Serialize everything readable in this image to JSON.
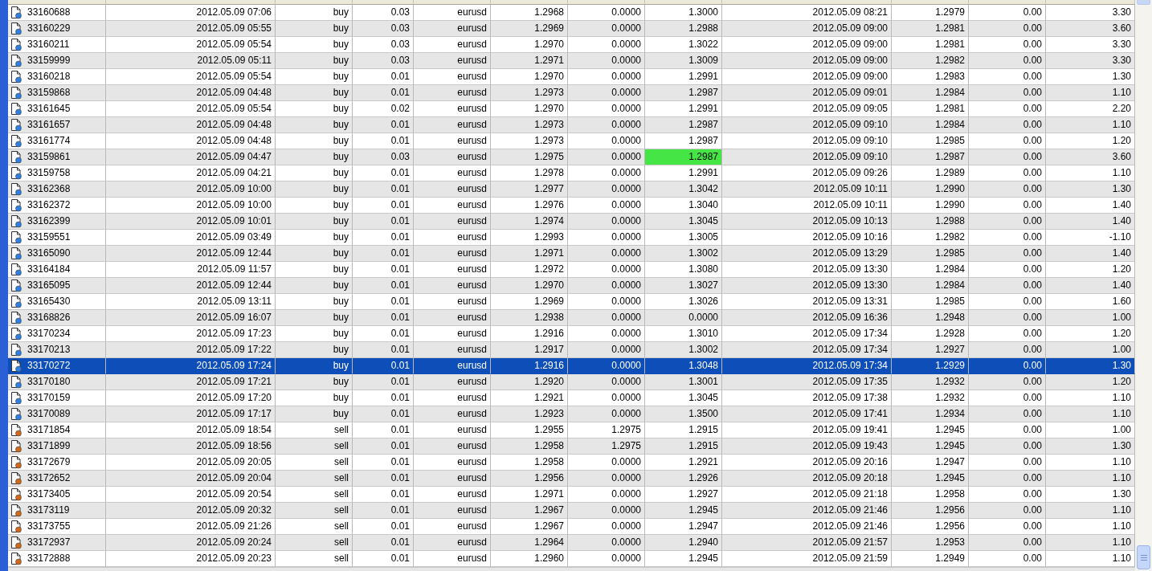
{
  "table": {
    "rows": [
      {
        "kind": "buy",
        "selected": false,
        "tp_highlighted": false,
        "cells": [
          "33160688",
          "2012.05.09 07:06",
          "buy",
          "0.03",
          "eurusd",
          "1.2968",
          "0.0000",
          "1.3000",
          "2012.05.09 08:21",
          "1.2979",
          "0.00",
          "3.30"
        ]
      },
      {
        "kind": "buy",
        "selected": false,
        "tp_highlighted": false,
        "cells": [
          "33160229",
          "2012.05.09 05:55",
          "buy",
          "0.03",
          "eurusd",
          "1.2969",
          "0.0000",
          "1.2988",
          "2012.05.09 09:00",
          "1.2981",
          "0.00",
          "3.60"
        ]
      },
      {
        "kind": "buy",
        "selected": false,
        "tp_highlighted": false,
        "cells": [
          "33160211",
          "2012.05.09 05:54",
          "buy",
          "0.03",
          "eurusd",
          "1.2970",
          "0.0000",
          "1.3022",
          "2012.05.09 09:00",
          "1.2981",
          "0.00",
          "3.30"
        ]
      },
      {
        "kind": "buy",
        "selected": false,
        "tp_highlighted": false,
        "cells": [
          "33159999",
          "2012.05.09 05:11",
          "buy",
          "0.03",
          "eurusd",
          "1.2971",
          "0.0000",
          "1.3009",
          "2012.05.09 09:00",
          "1.2982",
          "0.00",
          "3.30"
        ]
      },
      {
        "kind": "buy",
        "selected": false,
        "tp_highlighted": false,
        "cells": [
          "33160218",
          "2012.05.09 05:54",
          "buy",
          "0.01",
          "eurusd",
          "1.2970",
          "0.0000",
          "1.2991",
          "2012.05.09 09:00",
          "1.2983",
          "0.00",
          "1.30"
        ]
      },
      {
        "kind": "buy",
        "selected": false,
        "tp_highlighted": false,
        "cells": [
          "33159868",
          "2012.05.09 04:48",
          "buy",
          "0.01",
          "eurusd",
          "1.2973",
          "0.0000",
          "1.2987",
          "2012.05.09 09:01",
          "1.2984",
          "0.00",
          "1.10"
        ]
      },
      {
        "kind": "buy",
        "selected": false,
        "tp_highlighted": false,
        "cells": [
          "33161645",
          "2012.05.09 05:54",
          "buy",
          "0.02",
          "eurusd",
          "1.2970",
          "0.0000",
          "1.2991",
          "2012.05.09 09:05",
          "1.2981",
          "0.00",
          "2.20"
        ]
      },
      {
        "kind": "buy",
        "selected": false,
        "tp_highlighted": false,
        "cells": [
          "33161657",
          "2012.05.09 04:48",
          "buy",
          "0.01",
          "eurusd",
          "1.2973",
          "0.0000",
          "1.2987",
          "2012.05.09 09:10",
          "1.2984",
          "0.00",
          "1.10"
        ]
      },
      {
        "kind": "buy",
        "selected": false,
        "tp_highlighted": false,
        "cells": [
          "33161774",
          "2012.05.09 04:48",
          "buy",
          "0.01",
          "eurusd",
          "1.2973",
          "0.0000",
          "1.2987",
          "2012.05.09 09:10",
          "1.2985",
          "0.00",
          "1.20"
        ]
      },
      {
        "kind": "buy",
        "selected": false,
        "tp_highlighted": true,
        "cells": [
          "33159861",
          "2012.05.09 04:47",
          "buy",
          "0.03",
          "eurusd",
          "1.2975",
          "0.0000",
          "1.2987",
          "2012.05.09 09:10",
          "1.2987",
          "0.00",
          "3.60"
        ]
      },
      {
        "kind": "buy",
        "selected": false,
        "tp_highlighted": false,
        "cells": [
          "33159758",
          "2012.05.09 04:21",
          "buy",
          "0.01",
          "eurusd",
          "1.2978",
          "0.0000",
          "1.2991",
          "2012.05.09 09:26",
          "1.2989",
          "0.00",
          "1.10"
        ]
      },
      {
        "kind": "buy",
        "selected": false,
        "tp_highlighted": false,
        "cells": [
          "33162368",
          "2012.05.09 10:00",
          "buy",
          "0.01",
          "eurusd",
          "1.2977",
          "0.0000",
          "1.3042",
          "2012.05.09 10:11",
          "1.2990",
          "0.00",
          "1.30"
        ]
      },
      {
        "kind": "buy",
        "selected": false,
        "tp_highlighted": false,
        "cells": [
          "33162372",
          "2012.05.09 10:00",
          "buy",
          "0.01",
          "eurusd",
          "1.2976",
          "0.0000",
          "1.3040",
          "2012.05.09 10:11",
          "1.2990",
          "0.00",
          "1.40"
        ]
      },
      {
        "kind": "buy",
        "selected": false,
        "tp_highlighted": false,
        "cells": [
          "33162399",
          "2012.05.09 10:01",
          "buy",
          "0.01",
          "eurusd",
          "1.2974",
          "0.0000",
          "1.3045",
          "2012.05.09 10:13",
          "1.2988",
          "0.00",
          "1.40"
        ]
      },
      {
        "kind": "buy",
        "selected": false,
        "tp_highlighted": false,
        "cells": [
          "33159551",
          "2012.05.09 03:49",
          "buy",
          "0.01",
          "eurusd",
          "1.2993",
          "0.0000",
          "1.3005",
          "2012.05.09 10:16",
          "1.2982",
          "0.00",
          "-1.10"
        ]
      },
      {
        "kind": "buy",
        "selected": false,
        "tp_highlighted": false,
        "cells": [
          "33165090",
          "2012.05.09 12:44",
          "buy",
          "0.01",
          "eurusd",
          "1.2971",
          "0.0000",
          "1.3002",
          "2012.05.09 13:29",
          "1.2985",
          "0.00",
          "1.40"
        ]
      },
      {
        "kind": "buy",
        "selected": false,
        "tp_highlighted": false,
        "cells": [
          "33164184",
          "2012.05.09 11:57",
          "buy",
          "0.01",
          "eurusd",
          "1.2972",
          "0.0000",
          "1.3080",
          "2012.05.09 13:30",
          "1.2984",
          "0.00",
          "1.20"
        ]
      },
      {
        "kind": "buy",
        "selected": false,
        "tp_highlighted": false,
        "cells": [
          "33165095",
          "2012.05.09 12:44",
          "buy",
          "0.01",
          "eurusd",
          "1.2970",
          "0.0000",
          "1.3027",
          "2012.05.09 13:30",
          "1.2984",
          "0.00",
          "1.40"
        ]
      },
      {
        "kind": "buy",
        "selected": false,
        "tp_highlighted": false,
        "cells": [
          "33165430",
          "2012.05.09 13:11",
          "buy",
          "0.01",
          "eurusd",
          "1.2969",
          "0.0000",
          "1.3026",
          "2012.05.09 13:31",
          "1.2985",
          "0.00",
          "1.60"
        ]
      },
      {
        "kind": "buy",
        "selected": false,
        "tp_highlighted": false,
        "cells": [
          "33168826",
          "2012.05.09 16:07",
          "buy",
          "0.01",
          "eurusd",
          "1.2938",
          "0.0000",
          "0.0000",
          "2012.05.09 16:36",
          "1.2948",
          "0.00",
          "1.00"
        ]
      },
      {
        "kind": "buy",
        "selected": false,
        "tp_highlighted": false,
        "cells": [
          "33170234",
          "2012.05.09 17:23",
          "buy",
          "0.01",
          "eurusd",
          "1.2916",
          "0.0000",
          "1.3010",
          "2012.05.09 17:34",
          "1.2928",
          "0.00",
          "1.20"
        ]
      },
      {
        "kind": "buy",
        "selected": false,
        "tp_highlighted": false,
        "cells": [
          "33170213",
          "2012.05.09 17:22",
          "buy",
          "0.01",
          "eurusd",
          "1.2917",
          "0.0000",
          "1.3002",
          "2012.05.09 17:34",
          "1.2927",
          "0.00",
          "1.00"
        ]
      },
      {
        "kind": "buy",
        "selected": true,
        "tp_highlighted": false,
        "cells": [
          "33170272",
          "2012.05.09 17:24",
          "buy",
          "0.01",
          "eurusd",
          "1.2916",
          "0.0000",
          "1.3048",
          "2012.05.09 17:34",
          "1.2929",
          "0.00",
          "1.30"
        ]
      },
      {
        "kind": "buy",
        "selected": false,
        "tp_highlighted": false,
        "cells": [
          "33170180",
          "2012.05.09 17:21",
          "buy",
          "0.01",
          "eurusd",
          "1.2920",
          "0.0000",
          "1.3001",
          "2012.05.09 17:35",
          "1.2932",
          "0.00",
          "1.20"
        ]
      },
      {
        "kind": "buy",
        "selected": false,
        "tp_highlighted": false,
        "cells": [
          "33170159",
          "2012.05.09 17:20",
          "buy",
          "0.01",
          "eurusd",
          "1.2921",
          "0.0000",
          "1.3045",
          "2012.05.09 17:38",
          "1.2932",
          "0.00",
          "1.10"
        ]
      },
      {
        "kind": "buy",
        "selected": false,
        "tp_highlighted": false,
        "cells": [
          "33170089",
          "2012.05.09 17:17",
          "buy",
          "0.01",
          "eurusd",
          "1.2923",
          "0.0000",
          "1.3500",
          "2012.05.09 17:41",
          "1.2934",
          "0.00",
          "1.10"
        ]
      },
      {
        "kind": "sell",
        "selected": false,
        "tp_highlighted": false,
        "cells": [
          "33171854",
          "2012.05.09 18:54",
          "sell",
          "0.01",
          "eurusd",
          "1.2955",
          "1.2975",
          "1.2915",
          "2012.05.09 19:41",
          "1.2945",
          "0.00",
          "1.00"
        ]
      },
      {
        "kind": "sell",
        "selected": false,
        "tp_highlighted": false,
        "cells": [
          "33171899",
          "2012.05.09 18:56",
          "sell",
          "0.01",
          "eurusd",
          "1.2958",
          "1.2975",
          "1.2915",
          "2012.05.09 19:43",
          "1.2945",
          "0.00",
          "1.30"
        ]
      },
      {
        "kind": "sell",
        "selected": false,
        "tp_highlighted": false,
        "cells": [
          "33172679",
          "2012.05.09 20:05",
          "sell",
          "0.01",
          "eurusd",
          "1.2958",
          "0.0000",
          "1.2921",
          "2012.05.09 20:16",
          "1.2947",
          "0.00",
          "1.10"
        ]
      },
      {
        "kind": "sell",
        "selected": false,
        "tp_highlighted": false,
        "cells": [
          "33172652",
          "2012.05.09 20:04",
          "sell",
          "0.01",
          "eurusd",
          "1.2956",
          "0.0000",
          "1.2926",
          "2012.05.09 20:18",
          "1.2945",
          "0.00",
          "1.10"
        ]
      },
      {
        "kind": "sell",
        "selected": false,
        "tp_highlighted": false,
        "cells": [
          "33173405",
          "2012.05.09 20:54",
          "sell",
          "0.01",
          "eurusd",
          "1.2971",
          "0.0000",
          "1.2927",
          "2012.05.09 21:18",
          "1.2958",
          "0.00",
          "1.30"
        ]
      },
      {
        "kind": "sell",
        "selected": false,
        "tp_highlighted": false,
        "cells": [
          "33173119",
          "2012.05.09 20:32",
          "sell",
          "0.01",
          "eurusd",
          "1.2967",
          "0.0000",
          "1.2945",
          "2012.05.09 21:46",
          "1.2956",
          "0.00",
          "1.10"
        ]
      },
      {
        "kind": "sell",
        "selected": false,
        "tp_highlighted": false,
        "cells": [
          "33173755",
          "2012.05.09 21:26",
          "sell",
          "0.01",
          "eurusd",
          "1.2967",
          "0.0000",
          "1.2947",
          "2012.05.09 21:46",
          "1.2956",
          "0.00",
          "1.10"
        ]
      },
      {
        "kind": "sell",
        "selected": false,
        "tp_highlighted": false,
        "cells": [
          "33172937",
          "2012.05.09 20:24",
          "sell",
          "0.01",
          "eurusd",
          "1.2964",
          "0.0000",
          "1.2940",
          "2012.05.09 21:57",
          "1.2953",
          "0.00",
          "1.10"
        ]
      },
      {
        "kind": "sell",
        "selected": false,
        "tp_highlighted": false,
        "cells": [
          "33172888",
          "2012.05.09 20:23",
          "sell",
          "0.01",
          "eurusd",
          "1.2960",
          "0.0000",
          "1.2945",
          "2012.05.09 21:59",
          "1.2949",
          "0.00",
          "1.10"
        ]
      }
    ]
  }
}
